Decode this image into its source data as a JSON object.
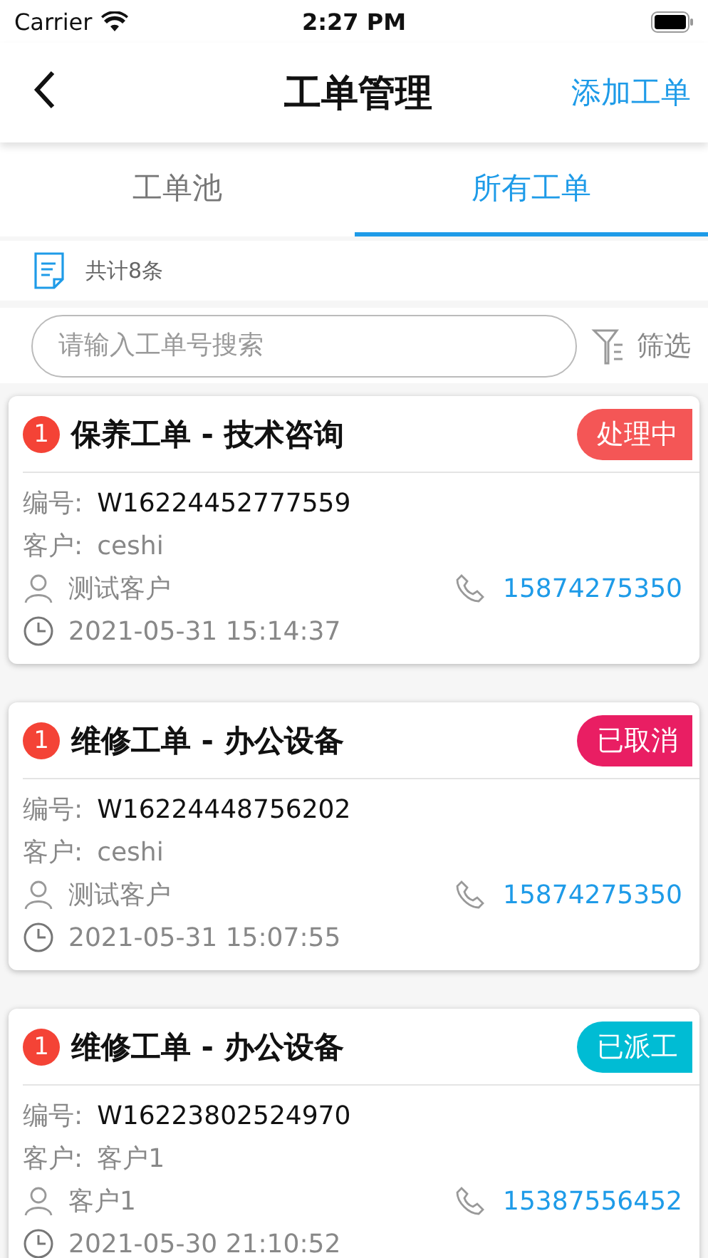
{
  "status_bar": {
    "carrier": "Carrier",
    "time": "2:27 PM"
  },
  "nav": {
    "title": "工单管理",
    "action": "添加工单"
  },
  "tabs": [
    {
      "label": "工单池",
      "selected": false
    },
    {
      "label": "所有工单",
      "selected": true
    }
  ],
  "summary": {
    "count": "共计8条"
  },
  "search": {
    "placeholder": "请输入工单号搜索",
    "filter": "筛选"
  },
  "orders": [
    {
      "badge": "1",
      "title": "保养工单 - 技术咨询",
      "status": "处理中",
      "color": "#f45656",
      "number_label": "编号:",
      "number": "W16224452777559",
      "customer_label": "客户:",
      "customer": "ceshi",
      "contact": "测试客户",
      "phone": "15874275350",
      "time": "2021-05-31 15:14:37"
    },
    {
      "badge": "1",
      "title": "维修工单 - 办公设备",
      "status": "已取消",
      "color": "#e91e63",
      "number_label": "编号:",
      "number": "W16224448756202",
      "customer_label": "客户:",
      "customer": "ceshi",
      "contact": "测试客户",
      "phone": "15874275350",
      "time": "2021-05-31 15:07:55"
    },
    {
      "badge": "1",
      "title": "维修工单 - 办公设备",
      "status": "已派工",
      "color": "#00bcd4",
      "number_label": "编号:",
      "number": "W16223802524970",
      "customer_label": "客户:",
      "customer": "客户1",
      "contact": "客户1",
      "phone": "15387556452",
      "time": "2021-05-30 21:10:52"
    }
  ]
}
